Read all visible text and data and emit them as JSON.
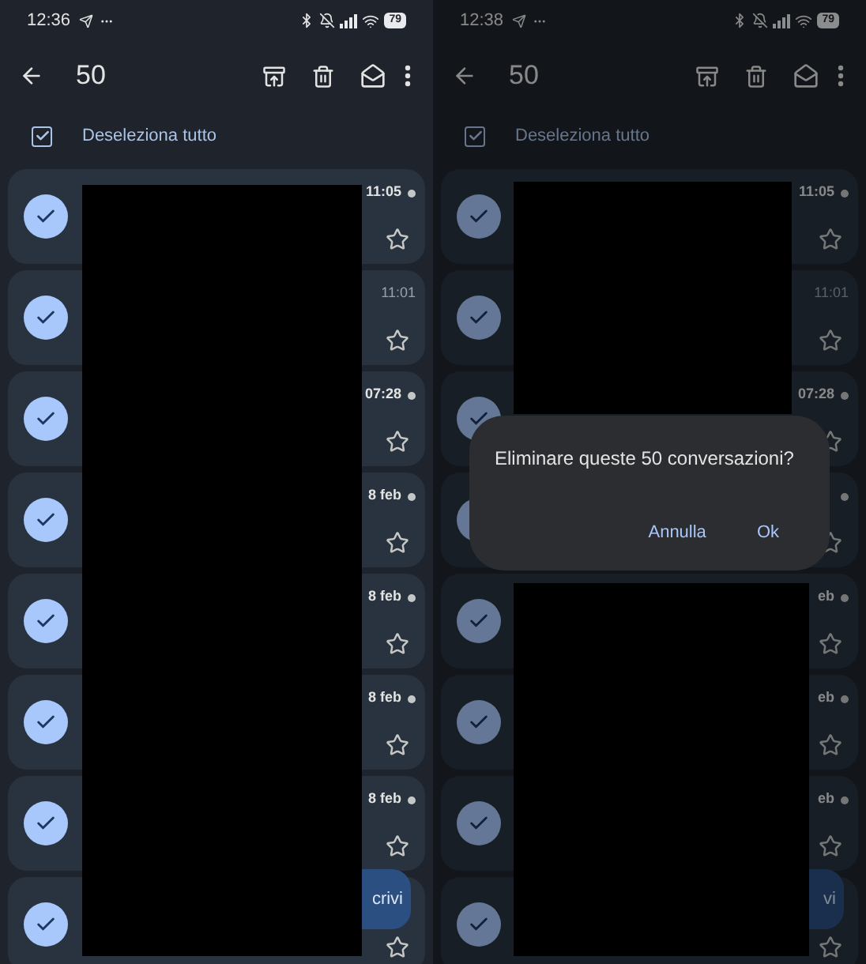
{
  "screens": [
    {
      "status": {
        "time": "12:36",
        "battery": "79"
      },
      "toolbar": {
        "count": "50"
      },
      "select_all": {
        "label": "Deseleziona tutto",
        "checked": true
      },
      "rows": [
        {
          "selected": true,
          "time": "11:05",
          "unread": true,
          "starred": false
        },
        {
          "selected": true,
          "time": "11:01",
          "unread": false,
          "starred": false
        },
        {
          "selected": true,
          "time": "07:28",
          "unread": true,
          "starred": false
        },
        {
          "selected": true,
          "time": "8 feb",
          "unread": true,
          "starred": false
        },
        {
          "selected": true,
          "time": "8 feb",
          "unread": true,
          "starred": false
        },
        {
          "selected": true,
          "time": "8 feb",
          "unread": true,
          "starred": false
        },
        {
          "selected": true,
          "time": "8 feb",
          "unread": true,
          "starred": false
        },
        {
          "selected": true,
          "starred": false
        }
      ],
      "fab": {
        "label": "crivi"
      }
    },
    {
      "status": {
        "time": "12:38",
        "battery": "79"
      },
      "toolbar": {
        "count": "50"
      },
      "select_all": {
        "label": "Deseleziona tutto",
        "checked": true
      },
      "rows": [
        {
          "selected": true,
          "time": "11:05",
          "unread": true,
          "starred": false
        },
        {
          "selected": true,
          "time": "11:01",
          "unread": false,
          "starred": false
        },
        {
          "selected": true,
          "time": "07:28",
          "unread": true,
          "starred": false
        },
        {
          "selected": true,
          "unread": true,
          "starred": false
        },
        {
          "selected": true,
          "time": "eb",
          "unread": true,
          "starred": false
        },
        {
          "selected": true,
          "time": "eb",
          "unread": true,
          "starred": false
        },
        {
          "selected": true,
          "time": "eb",
          "unread": true,
          "starred": false
        },
        {
          "selected": true,
          "starred": false
        }
      ],
      "fab": {
        "label": "vi"
      },
      "dialog": {
        "message": "Eliminare queste 50 conversazioni?",
        "buttons": [
          "Annulla",
          "Ok"
        ]
      }
    }
  ]
}
